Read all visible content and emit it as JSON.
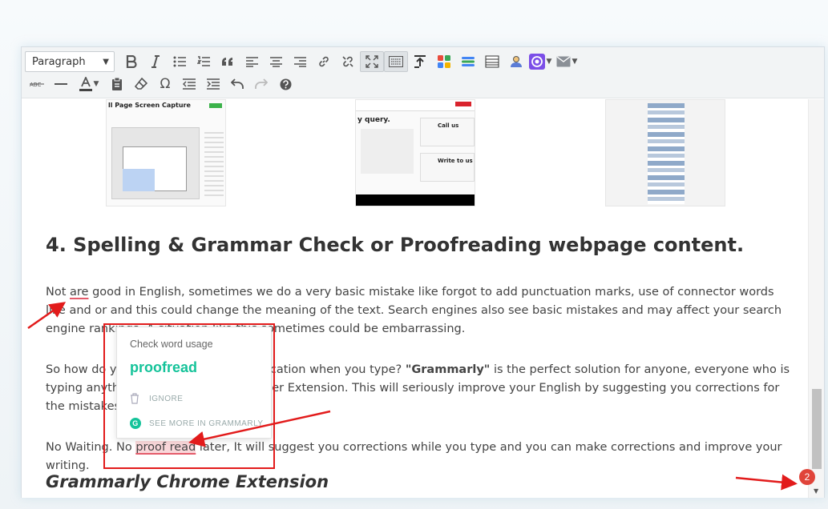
{
  "toolbar": {
    "format_select": "Paragraph",
    "colors": {
      "accent_purple": "#7b4ee8",
      "icon_gray": "#555555"
    }
  },
  "article": {
    "heading": "4. Spelling & Grammar Check or Proofreading webpage content.",
    "p1": {
      "w1": "Not ",
      "w2": "are",
      "w3": " good in English, sometimes we do a very basic mistake like forgot to add punctuation marks, use of connector words like and or and this could change the meaning of the text. Search engines also see basic mistakes and may affect your search engine rankings. A situation like this sometimes could be embarrassing."
    },
    "p2": {
      "a": "So how do you improve your communication when you type? ",
      "b": "\"Grammarly\"",
      "c": " is the perfect solution for anyone, everyone who is typing anything online. Get it as Browser Extension. This will seriously improve your English by suggesting you corrections for the mistakes you make."
    },
    "p3": {
      "a": "No Waiting. No ",
      "b": "proof read",
      "c": " later, It will suggest you corrections while you type and you can make corrections and improve your writing."
    },
    "subheading": "Grammarly Chrome Extension"
  },
  "thumbnails": {
    "shot1_title": "ll Page Screen Capture",
    "shot2_title": "y query.",
    "shot2_card1": "Call us",
    "shot2_card2": "Write to us"
  },
  "grammarly_popup": {
    "header": "Check word usage",
    "suggestion": "proofread",
    "ignore": "IGNORE",
    "see_more": "SEE MORE IN GRAMMARLY",
    "logo_letter": "G",
    "accent": "#15c39a"
  },
  "annotation": {
    "badge": "2",
    "color": "#e21b1b"
  }
}
